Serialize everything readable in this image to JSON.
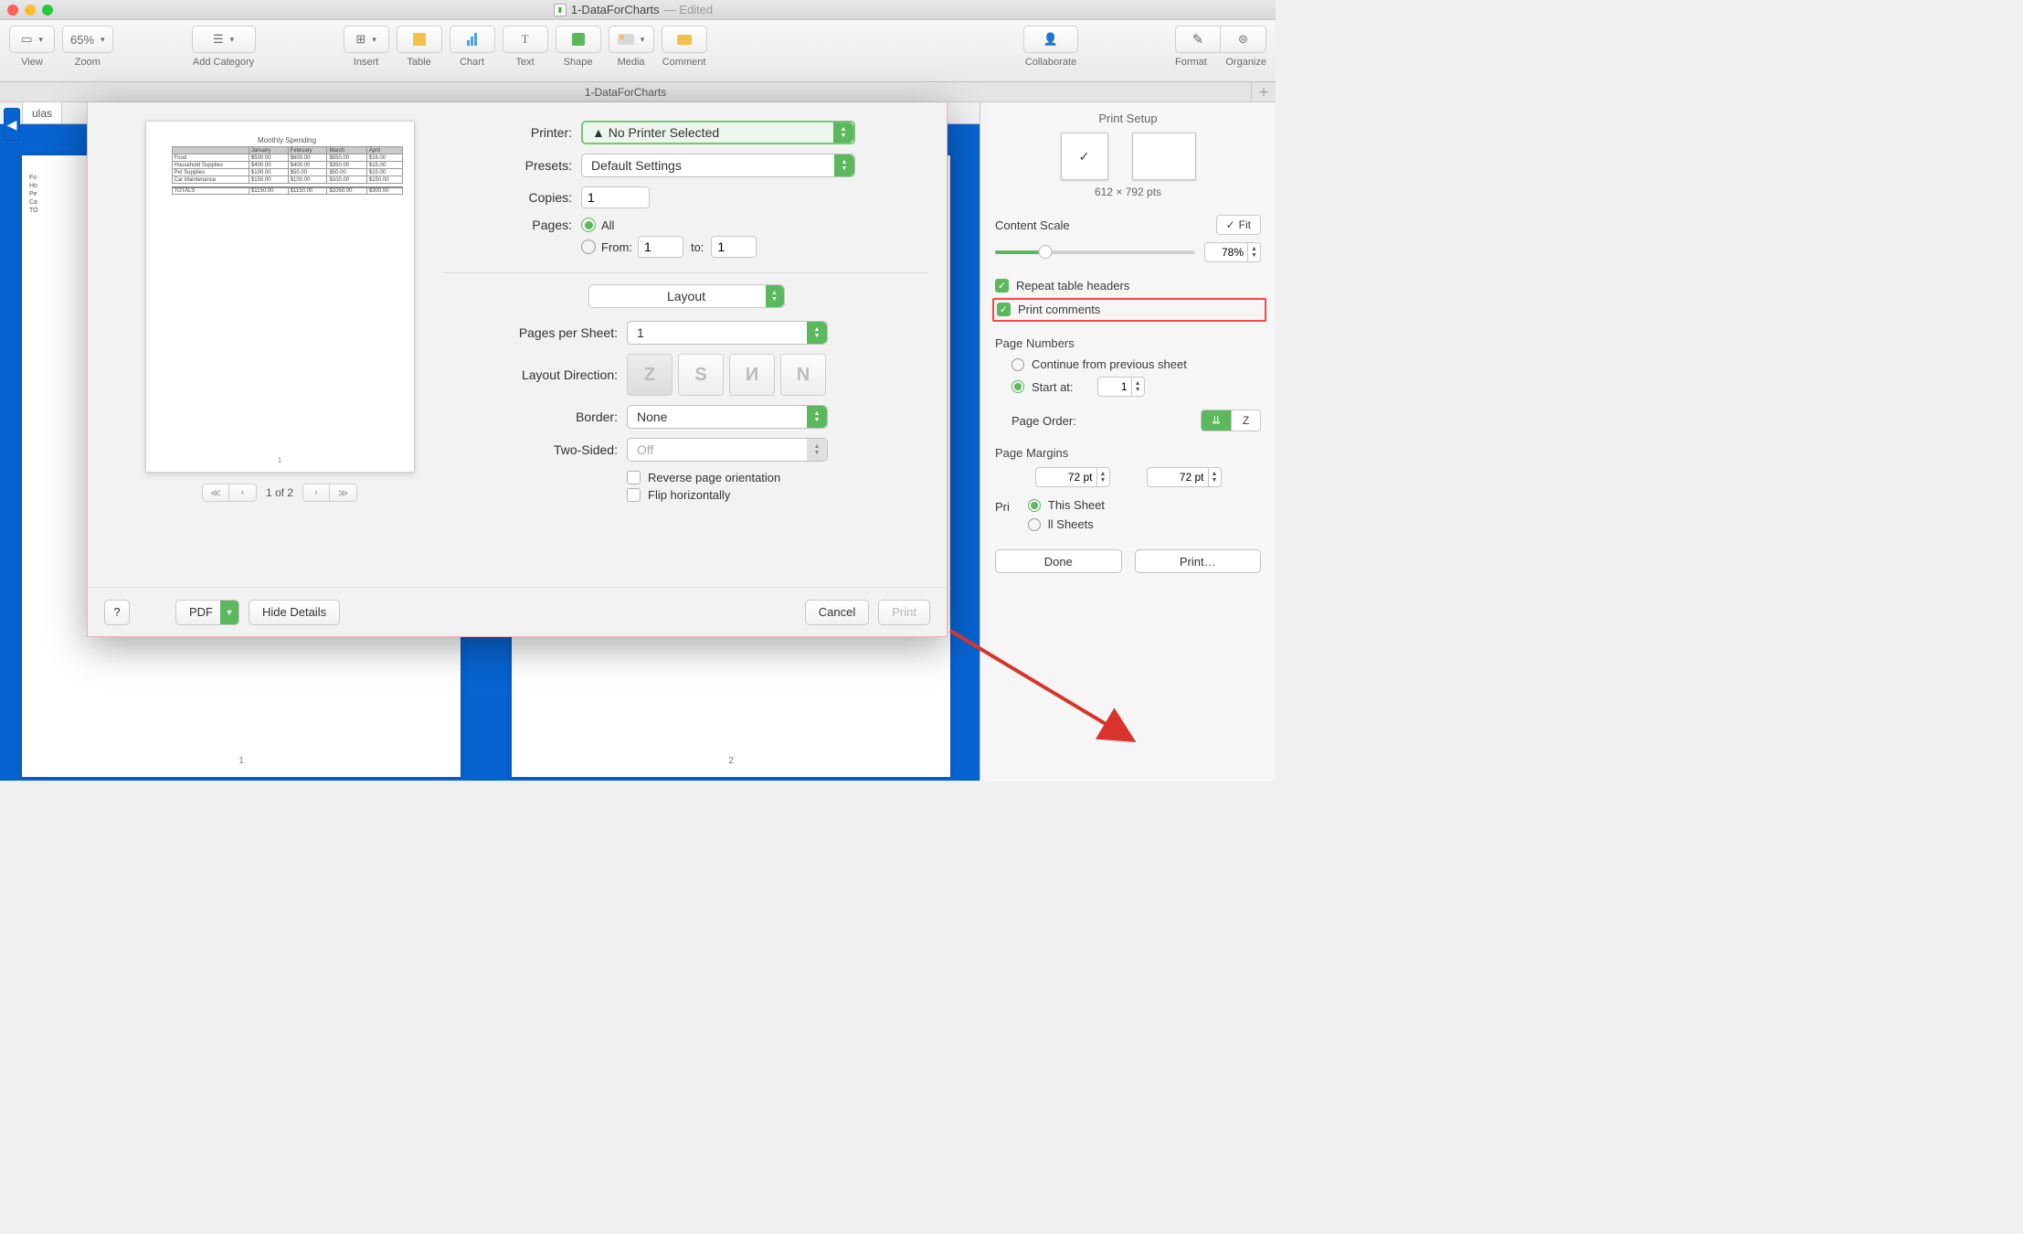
{
  "window": {
    "title": "1-DataForCharts",
    "edited": "— Edited",
    "tab": "1-DataForCharts"
  },
  "toolbar": {
    "view": "View",
    "zoom_value": "65%",
    "zoom": "Zoom",
    "add_category": "Add Category",
    "insert": "Insert",
    "table": "Table",
    "chart": "Chart",
    "text": "Text",
    "shape": "Shape",
    "media": "Media",
    "comment": "Comment",
    "collaborate": "Collaborate",
    "format": "Format",
    "organize": "Organize"
  },
  "canvas": {
    "sheet_tab": "ulas",
    "page1_num": "1",
    "page2_num": "2",
    "partial_rows": [
      "Fo",
      "Ho",
      "Pe",
      "Ca",
      "",
      "TO"
    ]
  },
  "print": {
    "printer_label": "Printer:",
    "printer_value": "No Printer Selected",
    "presets_label": "Presets:",
    "presets_value": "Default Settings",
    "copies_label": "Copies:",
    "copies_value": "1",
    "pages_label": "Pages:",
    "pages_all": "All",
    "pages_from": "From:",
    "pages_to": "to:",
    "from_value": "1",
    "to_value": "1",
    "layout_drop": "Layout",
    "pps_label": "Pages per Sheet:",
    "pps_value": "1",
    "dir_label": "Layout Direction:",
    "border_label": "Border:",
    "border_value": "None",
    "two_sided_label": "Two-Sided:",
    "two_sided_value": "Off",
    "reverse": "Reverse page orientation",
    "flip": "Flip horizontally",
    "preview_nav": "1 of 2",
    "preview": {
      "title": "Monthly Spending",
      "cols": [
        "",
        "January",
        "February",
        "March",
        "April"
      ],
      "rows": [
        [
          "Food",
          "$500.00",
          "$600.00",
          "$550.00",
          "$16.00"
        ],
        [
          "Household Supplies",
          "$400.00",
          "$400.00",
          "$350.00",
          "$15.00"
        ],
        [
          "Pet Supplies",
          "$100.00",
          "$50.00",
          "$50.00",
          "$15.00"
        ],
        [
          "Car Maintenance",
          "$150.00",
          "$100.00",
          "$100.00",
          "$150.00"
        ]
      ],
      "totals": [
        "TOTALS",
        "$1150.00",
        "$1150.00",
        "$1050.00",
        "$300.00"
      ],
      "page_num": "1"
    },
    "footer": {
      "help": "?",
      "pdf": "PDF",
      "hide_details": "Hide Details",
      "cancel": "Cancel",
      "print": "Print"
    }
  },
  "inspector": {
    "title": "Print Setup",
    "dims": "612 × 792 pts",
    "content_scale": "Content Scale",
    "fit": "Fit",
    "scale_value": "78%",
    "repeat_headers": "Repeat table headers",
    "print_comments": "Print comments",
    "page_numbers": "Page Numbers",
    "continue": "Continue from previous sheet",
    "start_at": "Start at:",
    "start_value": "1",
    "page_order": "Page Order:",
    "page_margins": "Page Margins",
    "margin_a": "72 pt",
    "margin_b": "72 pt",
    "print_scope": "Pri",
    "this_sheet": "This Sheet",
    "all_sheets": "ll Sheets",
    "done": "Done",
    "print": "Print…"
  }
}
